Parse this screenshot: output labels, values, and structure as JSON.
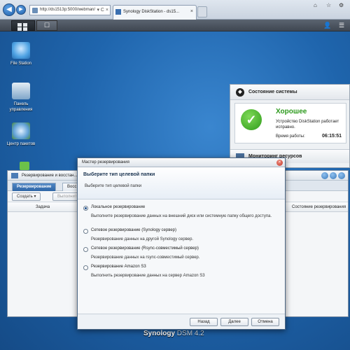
{
  "browser": {
    "back_icon": "back-arrow-icon",
    "forward_icon": "forward-arrow-icon",
    "url": "http://ds1513p:5000/webman/",
    "tab_title": "Synology DiskStation - ds15...",
    "tab_close": "×",
    "addr_controls": "▾ C ×",
    "window_controls": [
      "⌂",
      "☆",
      "⚙"
    ]
  },
  "taskbar": {
    "search_icon": "☐",
    "user_icon": "👤",
    "options_icon": "☰"
  },
  "desktop": {
    "icons": [
      {
        "label": "File Station",
        "icon": "file-station-icon",
        "color": "#4ea2e3"
      },
      {
        "label": "Панель управления",
        "icon": "control-panel-icon",
        "color": "#7fa6c9"
      },
      {
        "label": "Центр пакетов",
        "icon": "package-center-icon",
        "color": "#5fa0d6"
      }
    ],
    "brand": "Synology",
    "brand_version": "DSM 4.2"
  },
  "widget": {
    "title": "Состояние системы",
    "status": "Хорошее",
    "status_desc": "Устройство DiskStation работает исправно.",
    "uptime_label": "Время работы:",
    "uptime_value": "06:15:51",
    "resource_title": "Мониторинг ресурсов"
  },
  "bgwindow": {
    "title": "Резервирование и восстан...",
    "tabs": [
      "Резервирование",
      "Восс"
    ],
    "toolbar": [
      "Создать ▾",
      "Выполнить"
    ],
    "columns": [
      "Задача",
      "Состояние резервирования"
    ]
  },
  "wizard": {
    "title": "Мастер резервирования",
    "heading": "Выберите тип целевой папки",
    "subheading": "Выберите тип целевой папки",
    "options": [
      {
        "label": "Локальное резервирование",
        "desc": "Выполните резервирование данных на внешний диск или системную папку общего доступа.",
        "selected": true
      },
      {
        "label": "Сетевое резервирование (Synology сервер)",
        "desc": "Резервирование данных на другой Synology сервер.",
        "selected": false
      },
      {
        "label": "Сетевое резервирование (Rsync-совместимый сервер)",
        "desc": "Резервирование данных на rsync-совместимый сервер.",
        "selected": false
      },
      {
        "label": "Резервирование Amazon S3",
        "desc": "Выполнить резервирование данных на сервер Amazon S3",
        "selected": false
      }
    ],
    "buttons": {
      "back": "Назад",
      "next": "Далее",
      "cancel": "Отмена"
    }
  }
}
